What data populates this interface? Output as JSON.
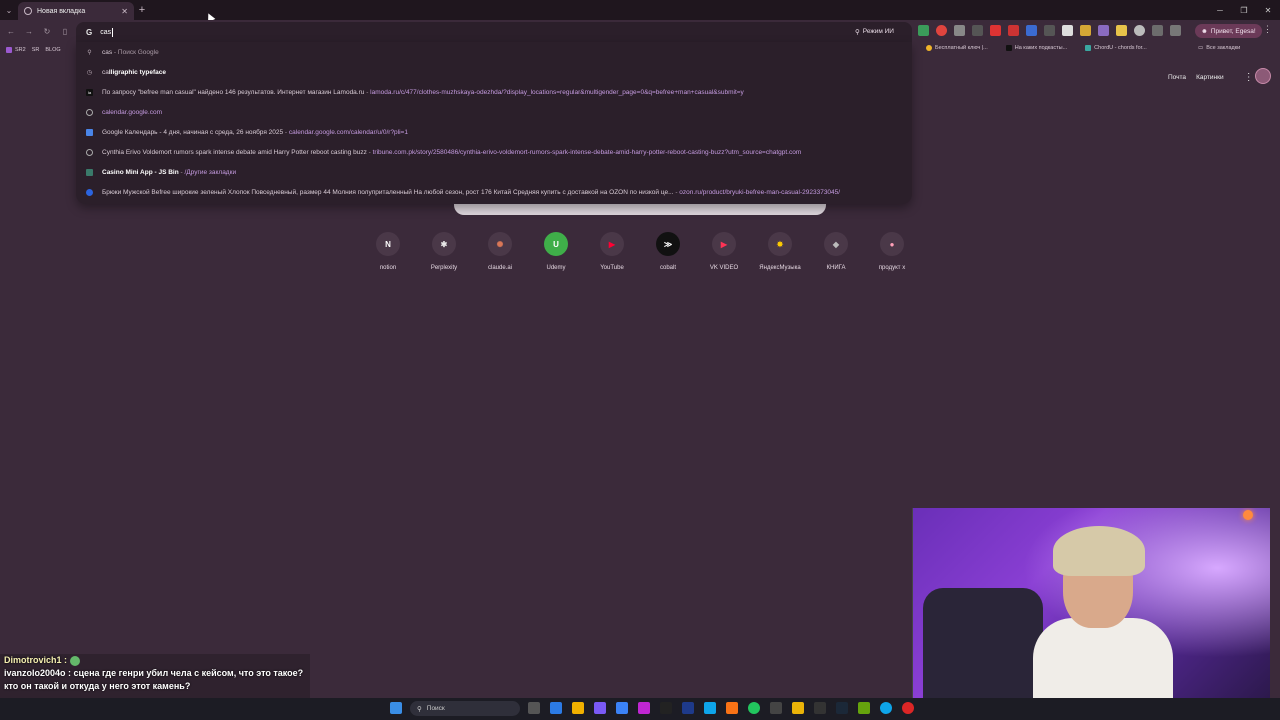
{
  "tab": {
    "title": "Новая вкладка"
  },
  "omnibox": {
    "value": "cas"
  },
  "toolbar": {
    "ai_mode_label": "Режим ИИ",
    "profile_label": "Привет, Egesa!"
  },
  "bookmarks": {
    "left": [
      "SR2",
      "SR",
      "BLOG"
    ],
    "right": [
      "Бесплатный ключ |...",
      "На каких подкасты...",
      "ChordU - chords for..."
    ],
    "all_label": "Все закладки"
  },
  "suggestions": [
    {
      "icon": "search-icon",
      "bold": "cas",
      "rest": "",
      "sep": " - ",
      "url": "Поиск Google"
    },
    {
      "icon": "history-icon",
      "pre": "ca",
      "bold": "lligraphic typeface",
      "rest": "",
      "sep": "",
      "url": ""
    },
    {
      "icon": "lamoda-icon",
      "text": "По запросу \"befree man casual\" найдено 146 результатов. Интернет магазин Lamoda.ru",
      "sep": " - ",
      "url": "lamoda.ru/c/477/clothes-muzhskaya-odezhda/?display_locations=regular&multigender_page=0&q=befree+man+casual&submit=y"
    },
    {
      "icon": "globe-icon",
      "text": "",
      "sep": "",
      "url": "calendar.google.com"
    },
    {
      "icon": "calendar-icon",
      "text": "Google Календарь - 4 дня, начиная с среда, 26 ноября 2025",
      "sep": " - ",
      "url": "calendar.google.com/calendar/u/0/r?pli=1"
    },
    {
      "icon": "globe-icon",
      "text": "Cynthia Erivo Voldemort rumors spark intense debate amid Harry Potter reboot casting buzz",
      "sep": " - ",
      "url": "tribune.com.pk/story/2580486/cynthia-erivo-voldemort-rumors-spark-intense-debate-amid-harry-potter-reboot-casting-buzz?utm_source=chatgpt.com"
    },
    {
      "icon": "bookmark-icon",
      "text": "Casino Mini App - JS Bin",
      "sep": " - ",
      "url": "/Другие закладки"
    },
    {
      "icon": "ozon-icon",
      "text": "Брюки Мужской Befree широкие зеленый Хлопок Повседневный, размер 44 Молния полуприталенный На любой сезон, рост 176 Китай Средняя купить с доставкой на OZON по низкой це...",
      "sep": " - ",
      "url": "ozon.ru/product/bryuki-befree-man-casual-2923373045/"
    }
  ],
  "toplinks": {
    "mail": "Почта",
    "images": "Картинки"
  },
  "shortcuts": [
    {
      "label": "notion",
      "glyph": "N",
      "color": "#ffffff"
    },
    {
      "label": "Perplexity",
      "glyph": "✱",
      "color": "#e8e8e8"
    },
    {
      "label": "claude.ai",
      "glyph": "✺",
      "color": "#d97757"
    },
    {
      "label": "Udemy",
      "glyph": "U",
      "color": "#3fae49"
    },
    {
      "label": "YouTube",
      "glyph": "▶",
      "color": "#ff0033"
    },
    {
      "label": "cobalt",
      "glyph": "≫",
      "color": "#ffffff"
    },
    {
      "label": "VK VIDEO",
      "glyph": "▶",
      "color": "#ff3355"
    },
    {
      "label": "ЯндексМузыка",
      "glyph": "✸",
      "color": "#ffcc00"
    },
    {
      "label": "КНИГА",
      "glyph": "◆",
      "color": "#bbbbbb"
    },
    {
      "label": "продукт х",
      "glyph": "●",
      "color": "#ff9fb8"
    }
  ],
  "chat": {
    "user1": "Dimotrovich1 :",
    "line2": "ivanzolo2004o : сцена где генри убил чела с кейсом, что это такое?",
    "line3": "кто он такой и откуда у него этот камень?"
  },
  "taskbar": {
    "search_label": "Поиск"
  },
  "colors": {
    "accent": "#c59be0",
    "background": "#3b2a3a",
    "dropdown": "#2b1f2a"
  }
}
